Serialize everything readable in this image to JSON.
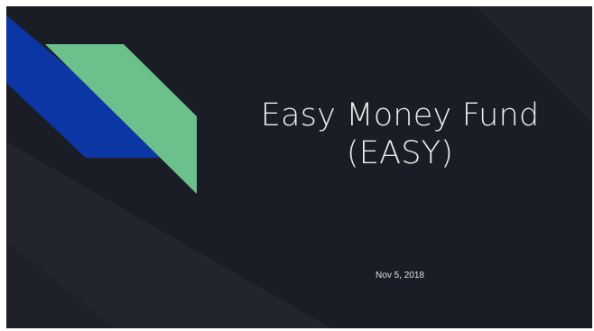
{
  "slide": {
    "title_line1": "Easy Money Fund",
    "title_line2": "(EASY)",
    "date": "Nov 5, 2018"
  },
  "colors": {
    "background": "#1a1d25",
    "blue_shape": "#0b36a3",
    "green_shape": "#6bc08c",
    "text": "#ececec"
  }
}
